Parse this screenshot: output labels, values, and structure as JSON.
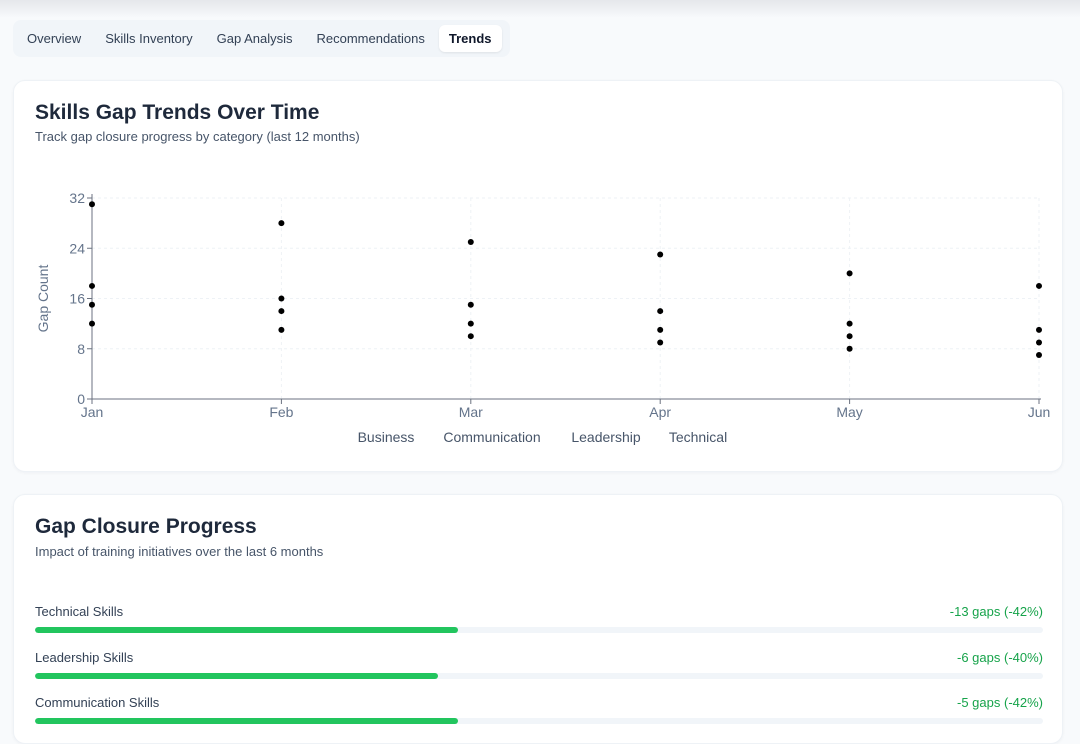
{
  "tabs": [
    {
      "label": "Overview",
      "active": false
    },
    {
      "label": "Skills Inventory",
      "active": false
    },
    {
      "label": "Gap Analysis",
      "active": false
    },
    {
      "label": "Recommendations",
      "active": false
    },
    {
      "label": "Trends",
      "active": true
    }
  ],
  "trends": {
    "title": "Skills Gap Trends Over Time",
    "subtitle": "Track gap closure progress by category (last 12 months)"
  },
  "chart_data": {
    "type": "scatter",
    "categories": [
      "Jan",
      "Feb",
      "Mar",
      "Apr",
      "May",
      "Jun"
    ],
    "ylabel": "Gap Count",
    "xlabel": "",
    "ylim": [
      0,
      32
    ],
    "yticks": [
      0,
      8,
      16,
      24,
      32
    ],
    "grid": true,
    "legend_position": "bottom",
    "series": [
      {
        "name": "Business",
        "values": [
          12,
          11,
          10,
          9,
          8,
          7
        ]
      },
      {
        "name": "Communication",
        "values": [
          15,
          14,
          12,
          11,
          10,
          9
        ]
      },
      {
        "name": "Leadership",
        "values": [
          18,
          16,
          15,
          14,
          12,
          11
        ]
      },
      {
        "name": "Technical",
        "values": [
          31,
          28,
          25,
          23,
          20,
          18
        ]
      }
    ],
    "marker_color": "#000000"
  },
  "closure": {
    "title": "Gap Closure Progress",
    "subtitle": "Impact of training initiatives over the last 6 months",
    "items": [
      {
        "label": "Technical Skills",
        "delta": "-13 gaps (-42%)",
        "progress": 42
      },
      {
        "label": "Leadership Skills",
        "delta": "-6 gaps (-40%)",
        "progress": 40
      },
      {
        "label": "Communication Skills",
        "delta": "-5 gaps (-42%)",
        "progress": 42
      }
    ]
  },
  "colors": {
    "accent": "#22c55e",
    "positive_text": "#16a34a",
    "track": "#f1f5f9"
  }
}
